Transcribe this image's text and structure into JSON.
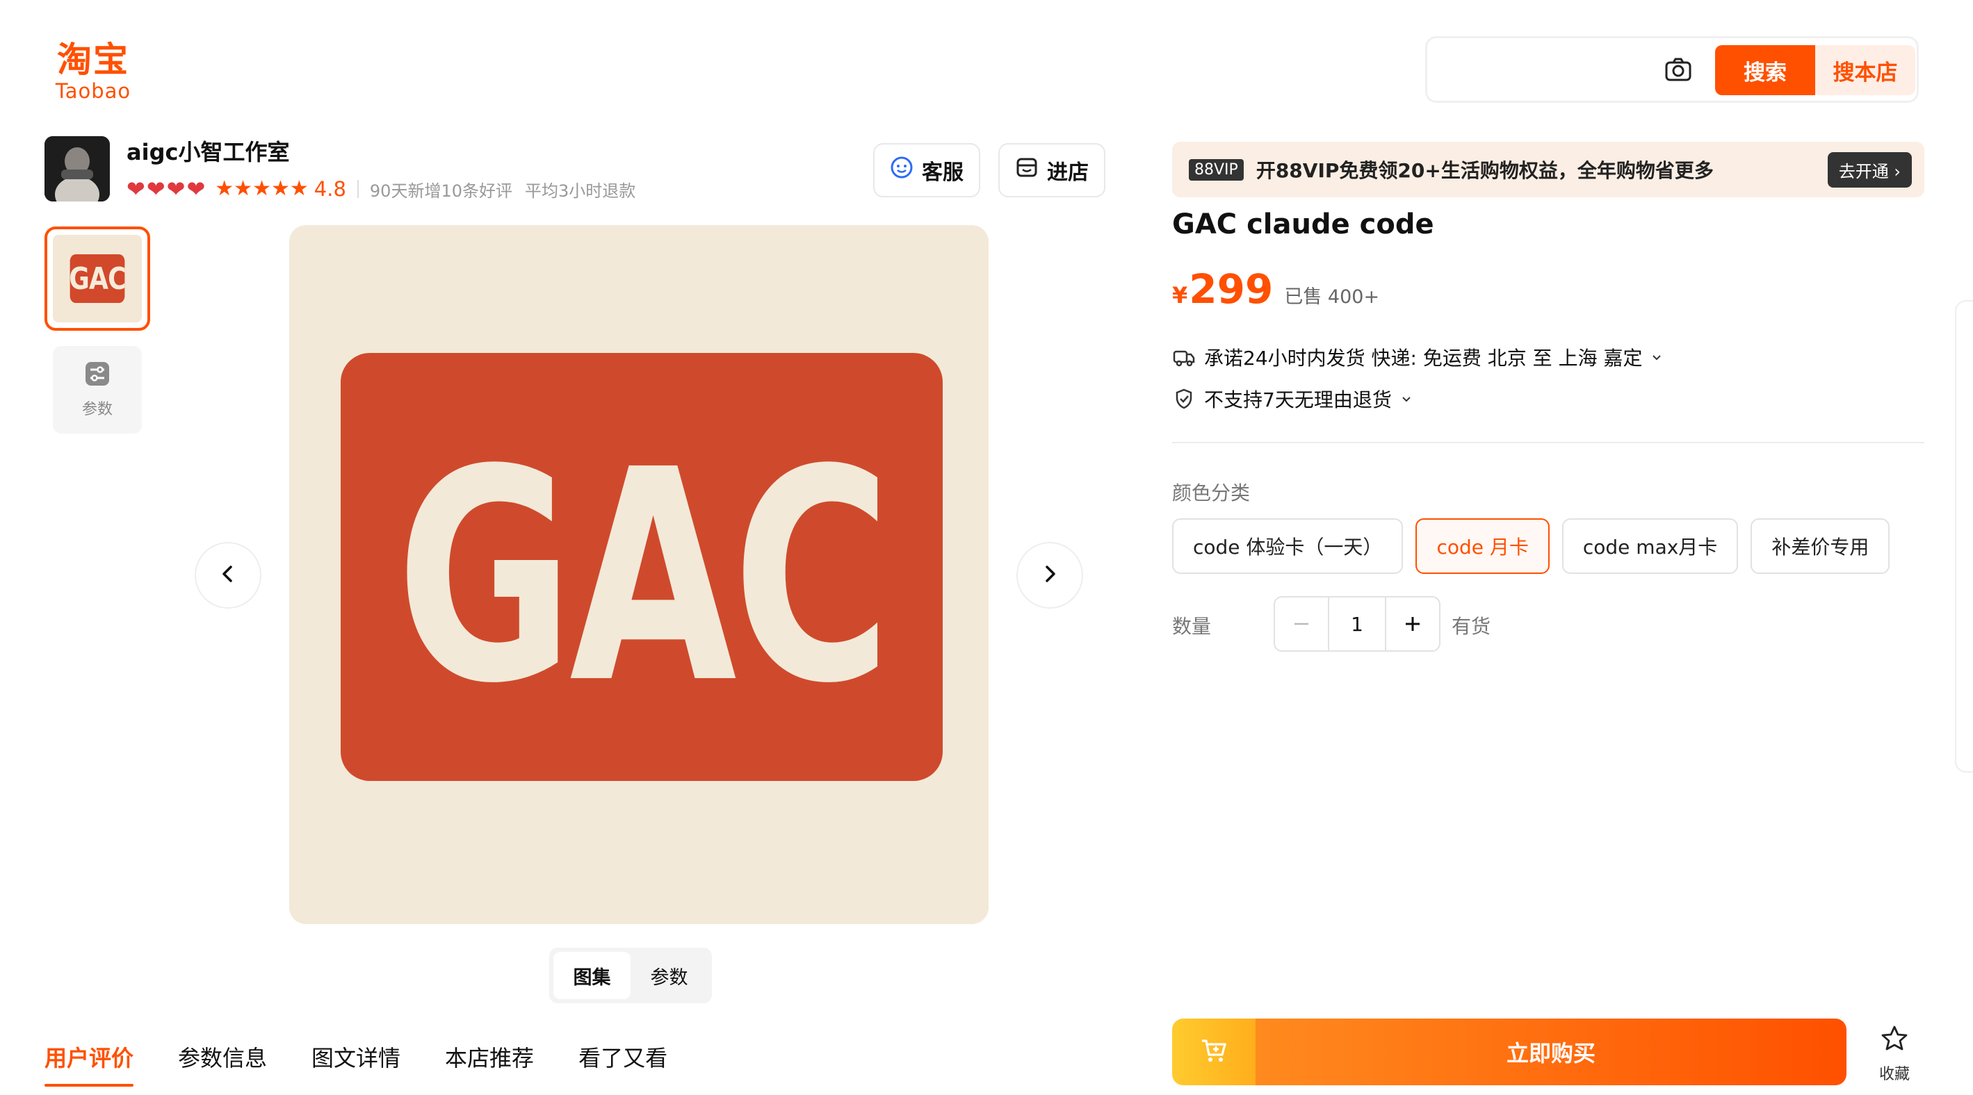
{
  "logo": {
    "cn": "淘宝",
    "en": "Taobao"
  },
  "search": {
    "placeholder": "",
    "search_label": "搜索",
    "store_search_label": "搜本店"
  },
  "shop": {
    "name": "aigc小智工作室",
    "hearts": 4,
    "stars": 5,
    "score": "4.8",
    "meta_reviews": "90天新增10条好评",
    "meta_refund": "平均3小时退款",
    "cs_label": "客服",
    "store_label": "进店"
  },
  "gallery": {
    "thumb_text": "GAC",
    "params_label": "参数",
    "main_text": "GAC",
    "tabs": [
      "图集",
      "参数"
    ],
    "active_tab": 0
  },
  "bottom_tabs": [
    "用户评价",
    "参数信息",
    "图文详情",
    "本店推荐",
    "看了又看"
  ],
  "vip": {
    "badge": "88VIP",
    "text": "开88VIP免费领20+生活购物权益，全年购物省更多",
    "button": "去开通 ›"
  },
  "product": {
    "title": "GAC claude code",
    "currency": "¥",
    "price": "299",
    "sold": "已售 400+",
    "shipping": "承诺24小时内发货  快递: 免运费  北京 至 上海 嘉定",
    "returns": "不支持7天无理由退货",
    "color_label": "颜色分类",
    "options": [
      "code 体验卡（一天）",
      "code 月卡",
      "code max月卡",
      "补差价专用"
    ],
    "selected_option": 1,
    "qty_label": "数量",
    "qty": "1",
    "stock": "有货",
    "buy_label": "立即购买",
    "fav_label": "收藏"
  },
  "colors": {
    "accent": "#ff5000",
    "brand_red": "#cf4a2c",
    "cream": "#f3e9d8"
  }
}
